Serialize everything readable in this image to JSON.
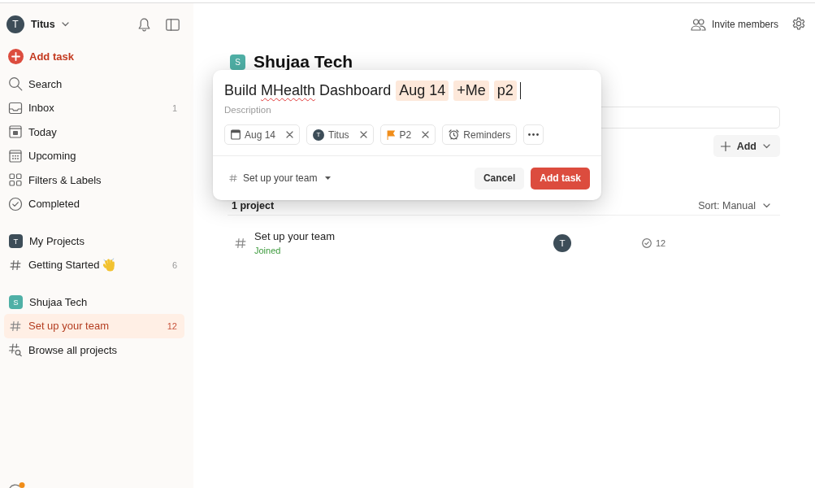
{
  "sidebar": {
    "user": {
      "initial": "T",
      "name": "Titus"
    },
    "add_task": "Add task",
    "nav": [
      {
        "kind": "search",
        "label": "Search",
        "selected": false
      },
      {
        "kind": "inbox",
        "label": "Inbox",
        "count": "1",
        "selected": false
      },
      {
        "kind": "today",
        "label": "Today",
        "selected": false
      },
      {
        "kind": "upcoming",
        "label": "Upcoming",
        "selected": false
      },
      {
        "kind": "filters",
        "label": "Filters & Labels",
        "selected": false
      },
      {
        "kind": "completed",
        "label": "Completed",
        "selected": false
      }
    ],
    "sections": [
      {
        "initial": "T",
        "color": "#3d4d58",
        "title": "My Projects",
        "projects": [
          {
            "kind": "emoji_hand",
            "label": "Getting Started",
            "count": "6",
            "selected": false
          }
        ]
      },
      {
        "initial": "S",
        "color": "#4fb0a6",
        "title": "Shujaa Tech",
        "projects": [
          {
            "kind": "plain",
            "label": "Set up your team",
            "count": "12",
            "selected": true
          }
        ]
      }
    ],
    "browse": "Browse all projects"
  },
  "header": {
    "invite": "Invite members"
  },
  "project": {
    "initial": "S",
    "title": "Shujaa Tech"
  },
  "toolbar": {
    "add": "Add"
  },
  "list": {
    "count_label": "1 project",
    "sort": "Sort: Manual",
    "rows": [
      {
        "name": "Set up your team",
        "status": "Joined",
        "member_initial": "T",
        "task_count": "12"
      }
    ]
  },
  "dialog": {
    "title_words": [
      {
        "text": "Build",
        "misspelled": false
      },
      {
        "text": "MHealth",
        "misspelled": true
      },
      {
        "text": "Dashboard",
        "misspelled": false
      }
    ],
    "title_tokens": [
      "Aug 14",
      "+Me",
      "p2"
    ],
    "description": {
      "placeholder": "Description"
    },
    "chips": [
      {
        "kind": "date",
        "label": "Aug 14",
        "removable": true
      },
      {
        "kind": "assignee",
        "initial": "T",
        "label": "Titus",
        "removable": true
      },
      {
        "kind": "priority",
        "label": "P2",
        "removable": true
      },
      {
        "kind": "reminders",
        "label": "Reminders",
        "removable": false
      },
      {
        "kind": "more"
      }
    ],
    "project_picker": "Set up your team",
    "buttons": [
      {
        "kind": "cancel",
        "label": "Cancel"
      },
      {
        "kind": "submit",
        "label": "Add task"
      }
    ]
  }
}
